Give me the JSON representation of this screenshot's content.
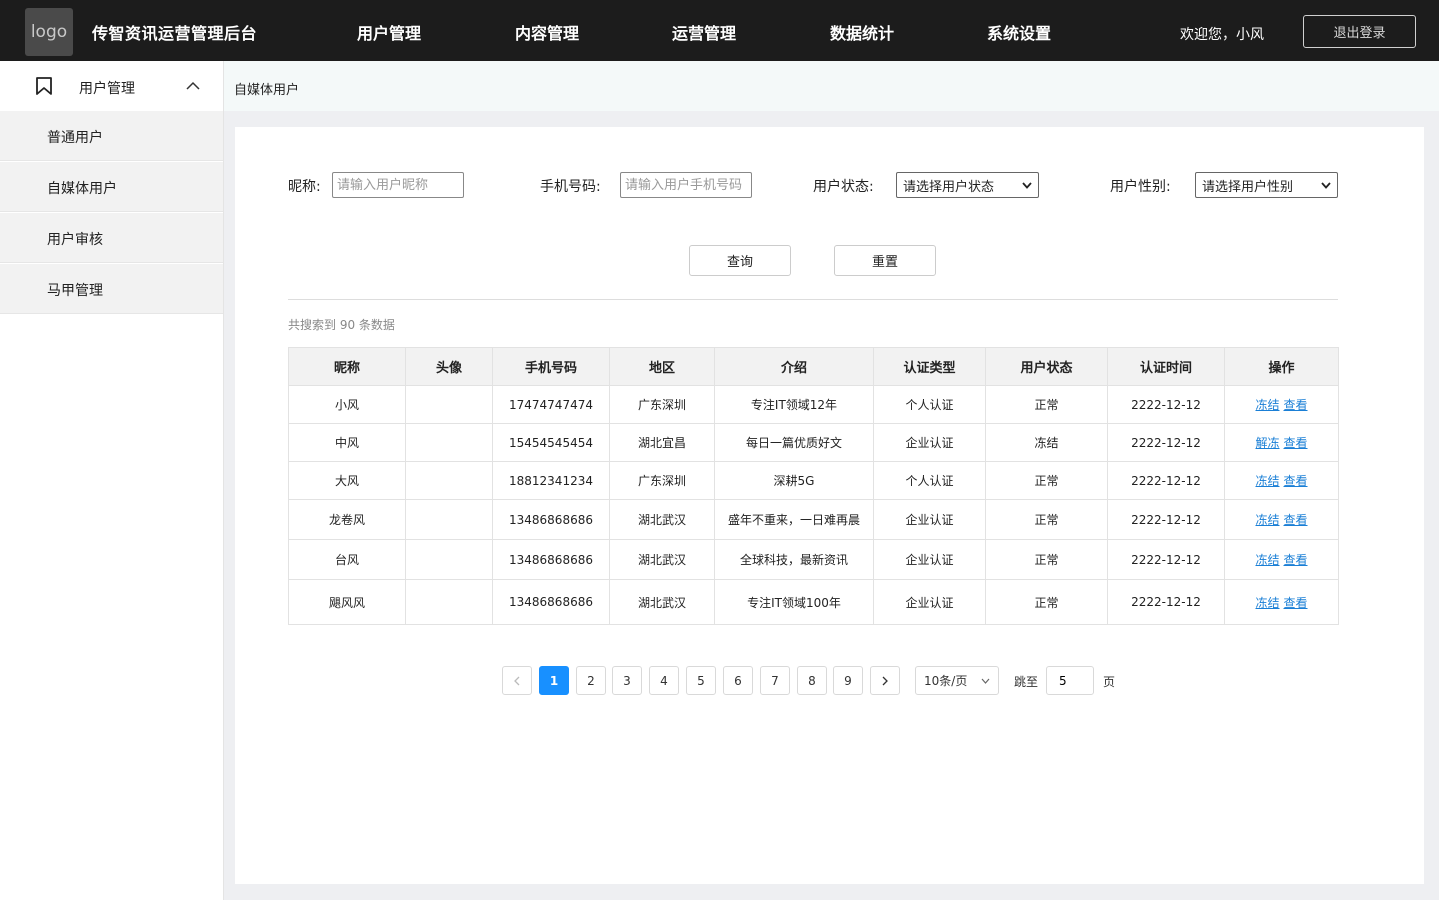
{
  "header": {
    "logo_text": "logo",
    "app_title": "传智资讯运营管理后台",
    "nav": [
      "用户管理",
      "内容管理",
      "运营管理",
      "数据统计",
      "系统设置"
    ],
    "welcome": "欢迎您，小风",
    "logout": "退出登录"
  },
  "sidebar": {
    "group_label": "用户管理",
    "items": [
      "普通用户",
      "自媒体用户",
      "用户审核",
      "马甲管理"
    ]
  },
  "breadcrumb": "自媒体用户",
  "filters": {
    "nickname_label": "昵称:",
    "nickname_placeholder": "请输入用户昵称",
    "phone_label": "手机号码:",
    "phone_placeholder": "请输入用户手机号码",
    "status_label": "用户状态:",
    "status_value": "请选择用户状态",
    "gender_label": "用户性别:",
    "gender_value": "请选择用户性别",
    "query": "查询",
    "reset": "重置"
  },
  "summary": "共搜索到 90 条数据",
  "table": {
    "headers": [
      "昵称",
      "头像",
      "手机号码",
      "地区",
      "介绍",
      "认证类型",
      "用户状态",
      "认证时间",
      "操作"
    ],
    "rows": [
      {
        "nickname": "小风",
        "avatar": "",
        "phone": "17474747474",
        "region": "广东深圳",
        "intro": "专注IT领域12年",
        "auth_type": "个人认证",
        "status": "正常",
        "time": "2222-12-12",
        "action": "冻结",
        "view": "查看"
      },
      {
        "nickname": "中风",
        "avatar": "",
        "phone": "15454545454",
        "region": "湖北宜昌",
        "intro": "每日一篇优质好文",
        "auth_type": "企业认证",
        "status": "冻结",
        "time": "2222-12-12",
        "action": "解冻",
        "view": "查看"
      },
      {
        "nickname": "大风",
        "avatar": "",
        "phone": "18812341234",
        "region": "广东深圳",
        "intro": "深耕5G",
        "auth_type": "个人认证",
        "status": "正常",
        "time": "2222-12-12",
        "action": "冻结",
        "view": "查看"
      },
      {
        "nickname": "龙卷风",
        "avatar": "",
        "phone": "13486868686",
        "region": "湖北武汉",
        "intro": "盛年不重来，一日难再晨",
        "auth_type": "企业认证",
        "status": "正常",
        "time": "2222-12-12",
        "action": "冻结",
        "view": "查看"
      },
      {
        "nickname": "台风",
        "avatar": "",
        "phone": "13486868686",
        "region": "湖北武汉",
        "intro": "全球科技，最新资讯",
        "auth_type": "企业认证",
        "status": "正常",
        "time": "2222-12-12",
        "action": "冻结",
        "view": "查看"
      },
      {
        "nickname": "飓风风",
        "avatar": "",
        "phone": "13486868686",
        "region": "湖北武汉",
        "intro": "专注IT领域100年",
        "auth_type": "企业认证",
        "status": "正常",
        "time": "2222-12-12",
        "action": "冻结",
        "view": "查看"
      }
    ]
  },
  "pagination": {
    "pages": [
      "1",
      "2",
      "3",
      "4",
      "5",
      "6",
      "7",
      "8",
      "9"
    ],
    "current": "1",
    "page_size": "10条/页",
    "jump_label": "跳至",
    "jump_value": "5",
    "page_suffix": "页"
  },
  "colors": {
    "topbar": "#1c1c1c",
    "accent": "#1890ff",
    "link": "#1a7fd6"
  }
}
